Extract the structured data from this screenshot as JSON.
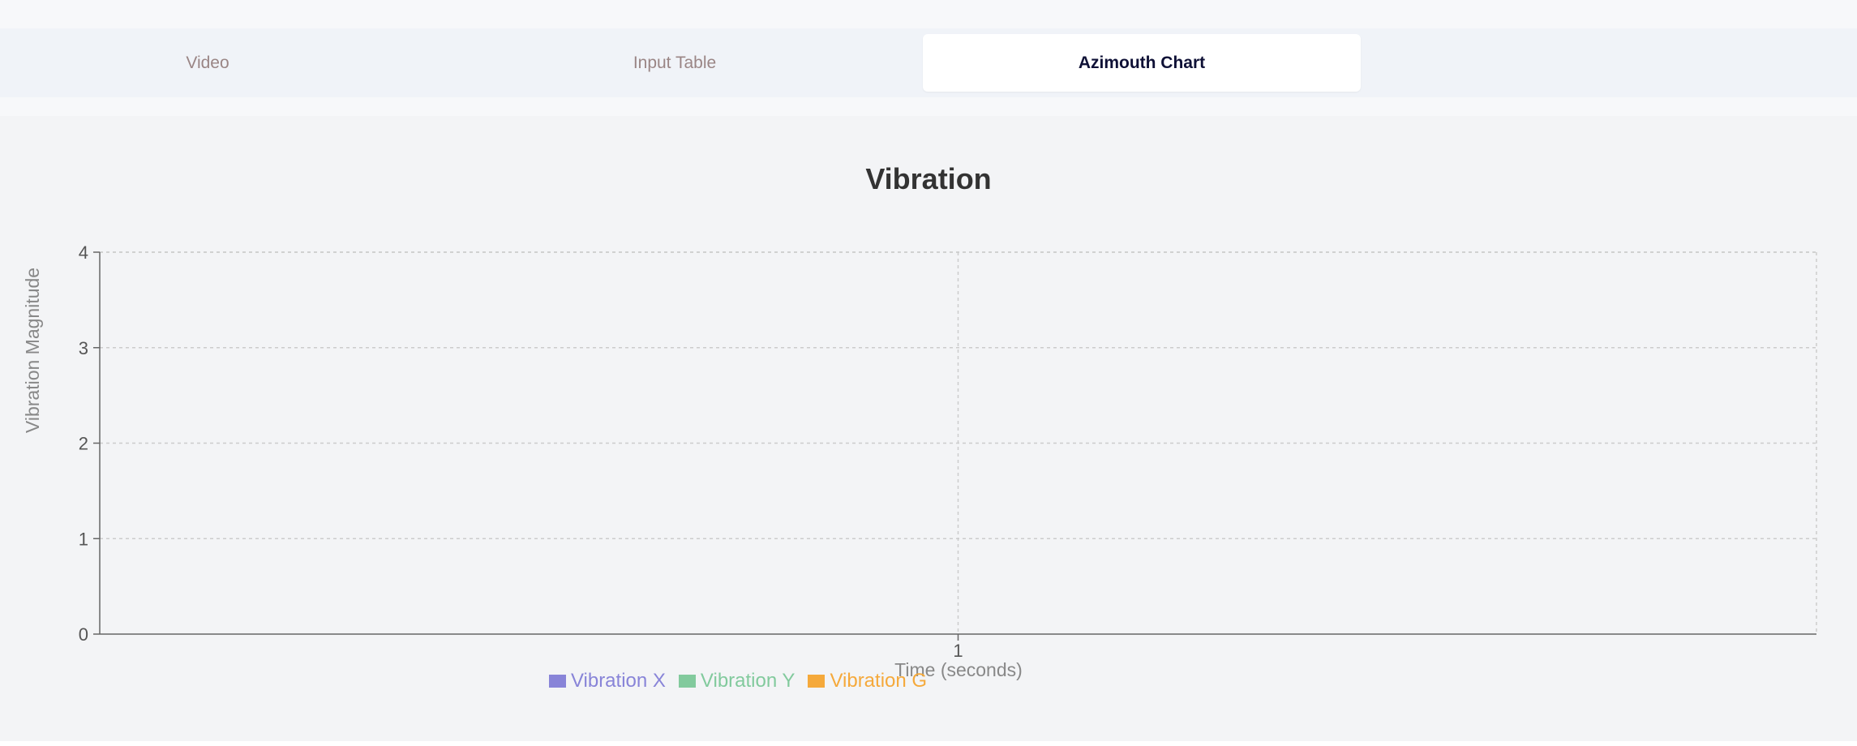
{
  "tabs": [
    {
      "label": "Video",
      "active": false
    },
    {
      "label": "Input Table",
      "active": false
    },
    {
      "label": "Azimouth Chart",
      "active": true
    }
  ],
  "chart_data": {
    "type": "bar",
    "title": "Vibration",
    "xlabel": "Time (seconds)",
    "ylabel": "Vibration Magnitude",
    "categories": [
      "1"
    ],
    "ylim": [
      0,
      4
    ],
    "yticks": [
      0,
      1,
      2,
      3,
      4
    ],
    "grid": true,
    "legend_position": "bottom",
    "series": [
      {
        "name": "Vibration X",
        "color": "#8884d8",
        "values": [
          null
        ]
      },
      {
        "name": "Vibration Y",
        "color": "#82ca9d",
        "values": [
          null
        ]
      },
      {
        "name": "Vibration G",
        "color": "#f5a93b",
        "values": [
          null
        ]
      }
    ]
  }
}
